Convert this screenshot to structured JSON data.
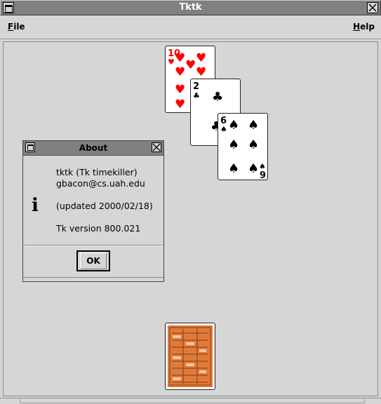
{
  "window": {
    "title": "Tktk"
  },
  "menubar": {
    "file": "File",
    "help": "Help"
  },
  "cards": {
    "ten_hearts": {
      "rank": "10",
      "suit": "hearts",
      "color": "#ff0000"
    },
    "two_clubs": {
      "rank": "2",
      "suit": "clubs",
      "color": "#000000"
    },
    "six_spades": {
      "rank": "6",
      "suit": "spades",
      "color": "#000000",
      "rank_bottom": "9"
    },
    "deck": {
      "face": "back",
      "color": "#e07a3a"
    }
  },
  "about": {
    "title": "About",
    "line1": "tktk (Tk timekiller)",
    "line2": "gbacon@cs.uah.edu",
    "line3": "(updated 2000/02/18)",
    "line4": "Tk version 800.021",
    "ok_label": "OK",
    "icon": "info-icon"
  }
}
